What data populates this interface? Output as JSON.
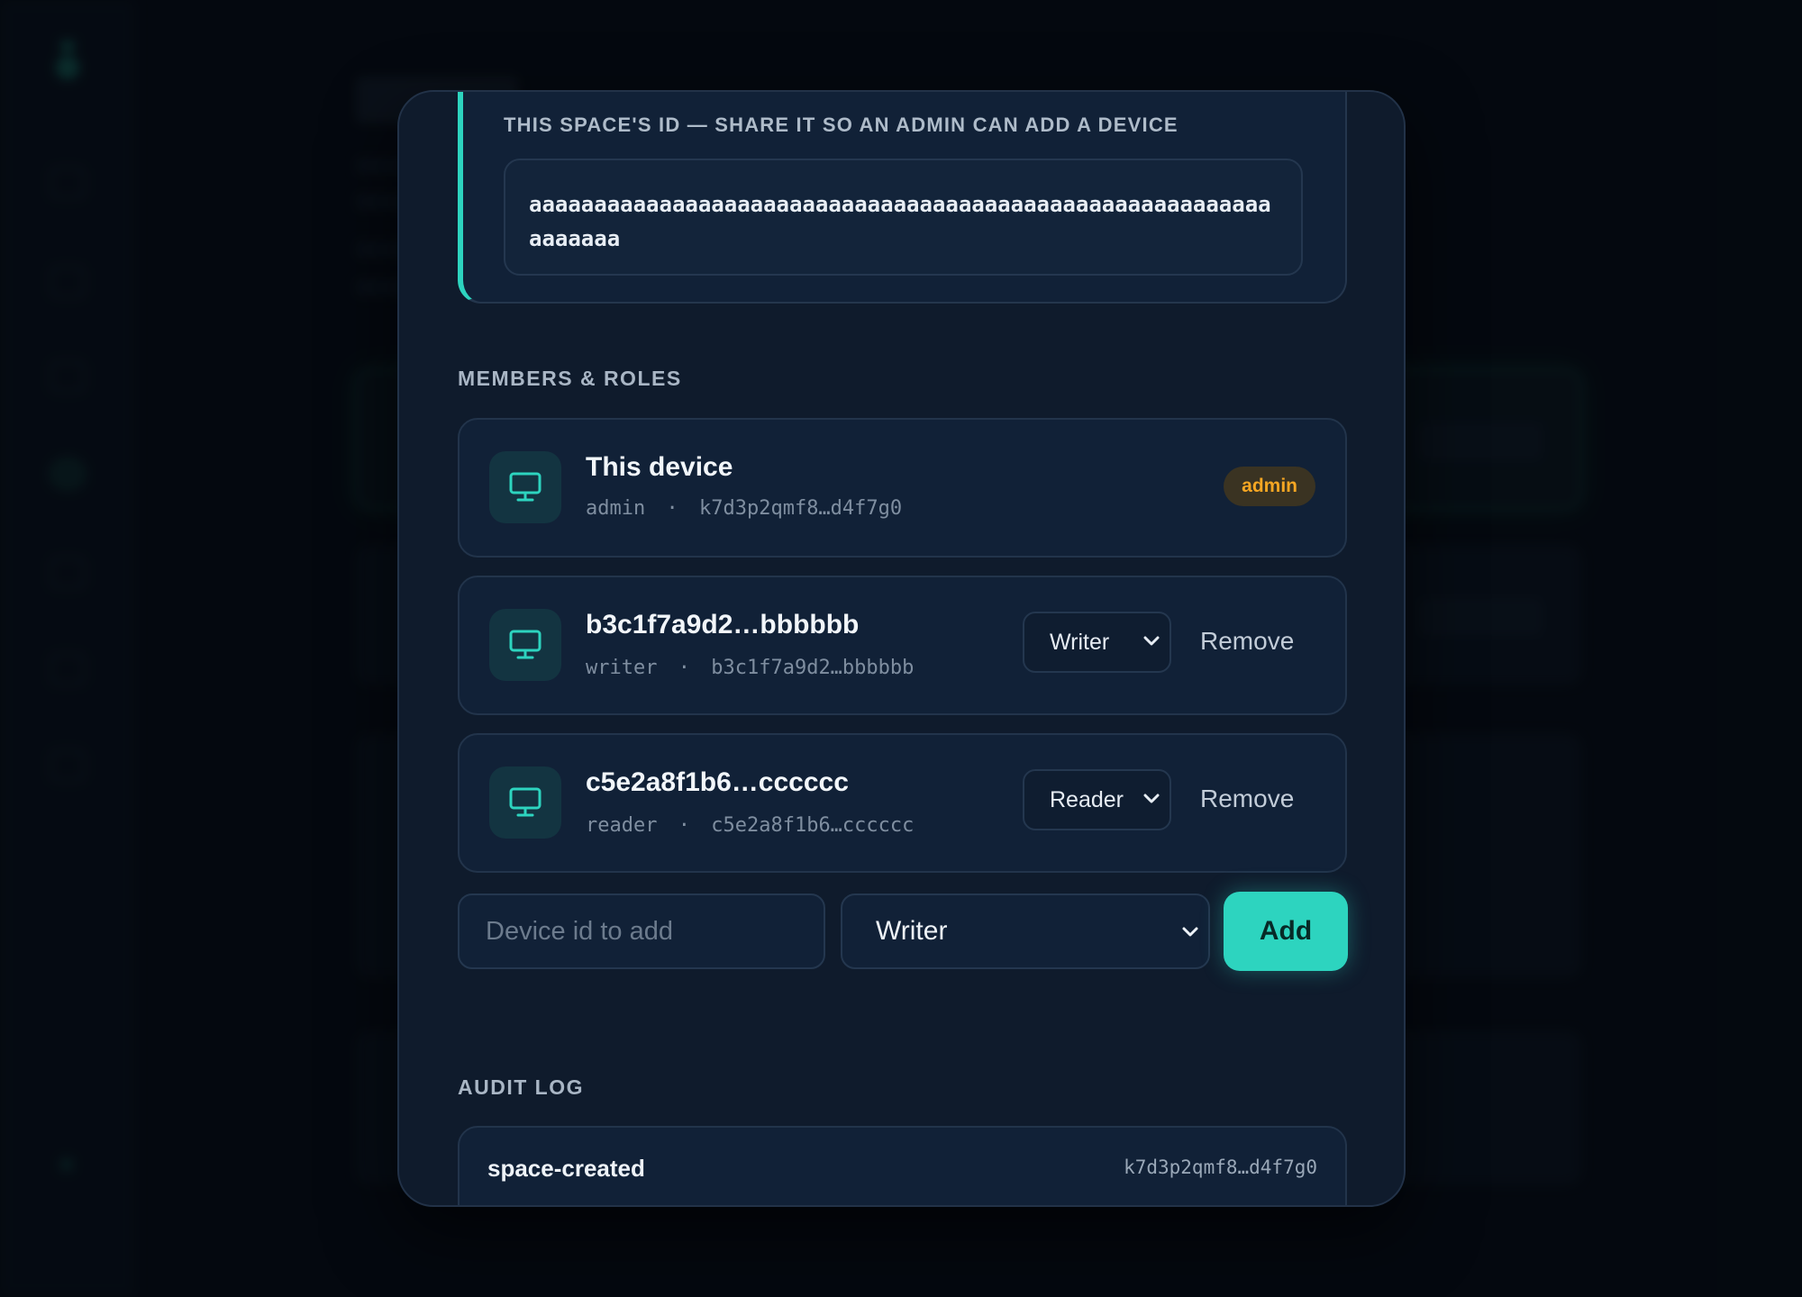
{
  "modal": {
    "space_id_label": "THIS SPACE'S ID — SHARE IT SO AN ADMIN CAN ADD A DEVICE",
    "space_id_value": "aaaaaaaaaaaaaaaaaaaaaaaaaaaaaaaaaaaaaaaaaaaaaaaaaaaaaaaaaaaaaaaa",
    "members_title": "MEMBERS & ROLES",
    "members": [
      {
        "name": "This device",
        "role": "admin",
        "separator": "·",
        "id": "k7d3p2qmf8…d4f7g0",
        "badge": "admin"
      },
      {
        "name": "b3c1f7a9d2…bbbbbb",
        "role": "writer",
        "separator": "·",
        "id": "b3c1f7a9d2…bbbbbb",
        "select_value": "Writer",
        "remove_label": "Remove"
      },
      {
        "name": "c5e2a8f1b6…cccccc",
        "role": "reader",
        "separator": "·",
        "id": "c5e2a8f1b6…cccccc",
        "select_value": "Reader",
        "remove_label": "Remove"
      }
    ],
    "add_form": {
      "device_placeholder": "Device id to add",
      "role_value": "Writer",
      "add_label": "Add"
    },
    "audit_title": "AUDIT LOG",
    "audit": [
      {
        "event": "space-created",
        "actor": "k7d3p2qmf8…d4f7g0"
      }
    ]
  },
  "colors": {
    "accent": "#2dd4bf",
    "admin_badge": "#f5a623",
    "modal_bg": "#0f1b2c"
  },
  "icons": {
    "device": "monitor-icon",
    "chevron": "chevron-down-icon"
  }
}
